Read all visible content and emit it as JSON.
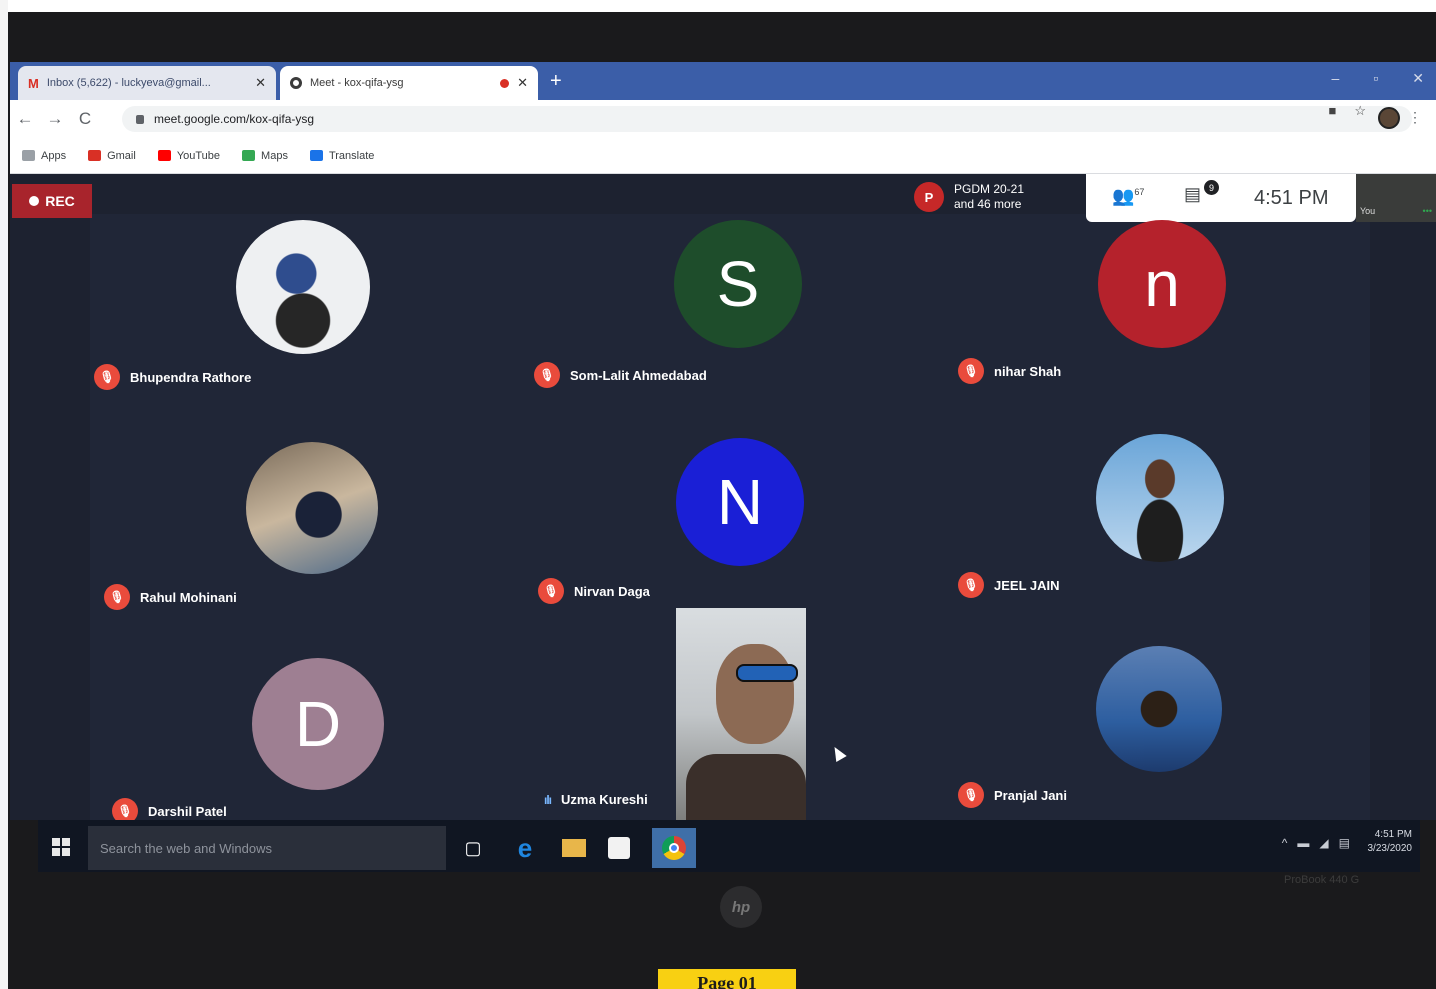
{
  "browser": {
    "tabs": [
      {
        "title": "Inbox (5,622) - luckyeva@gmail...",
        "icon": "gmail-icon"
      },
      {
        "title": "Meet - kox-qifa-ysg",
        "icon": "meet-icon"
      }
    ],
    "url": "meet.google.com/kox-qifa-ysg",
    "bookmarks": [
      {
        "label": "Apps",
        "color": "#5f6368"
      },
      {
        "label": "Gmail",
        "color": "#d93025"
      },
      {
        "label": "YouTube",
        "color": "#ff0000"
      },
      {
        "label": "Maps",
        "color": "#34a853"
      },
      {
        "label": "Translate",
        "color": "#1a73e8"
      }
    ]
  },
  "meet": {
    "rec_label": "REC",
    "presenter": {
      "initial": "P",
      "line1": "PGDM 20-21",
      "line2": "and 46 more"
    },
    "people_count": "67",
    "chat_badge": "9",
    "time": "4:51 PM",
    "self_label": "You",
    "participants": [
      {
        "name": "Bhupendra Rathore",
        "avatar": "photo"
      },
      {
        "name": "Som-Lalit Ahmedabad",
        "initial": "S",
        "color": "#1e4d2b"
      },
      {
        "name": "nihar Shah",
        "initial": "n",
        "color": "#b5222c"
      },
      {
        "name": "Rahul Mohinani",
        "avatar": "photo"
      },
      {
        "name": "Nirvan Daga",
        "initial": "N",
        "color": "#1a1fd6"
      },
      {
        "name": "JEEL JAIN",
        "avatar": "photo"
      },
      {
        "name": "Darshil Patel",
        "initial": "D",
        "color": "#9e7f92"
      },
      {
        "name": "Uzma Kureshi",
        "avatar": "video"
      },
      {
        "name": "Pranjal Jani",
        "avatar": "photo"
      }
    ]
  },
  "taskbar": {
    "search_placeholder": "Search the web and Windows",
    "clock_time": "4:51 PM",
    "clock_date": "3/23/2020"
  },
  "hardware": {
    "brand": "hp",
    "model": "ProBook 440 G"
  },
  "page_tag": "Page 01"
}
